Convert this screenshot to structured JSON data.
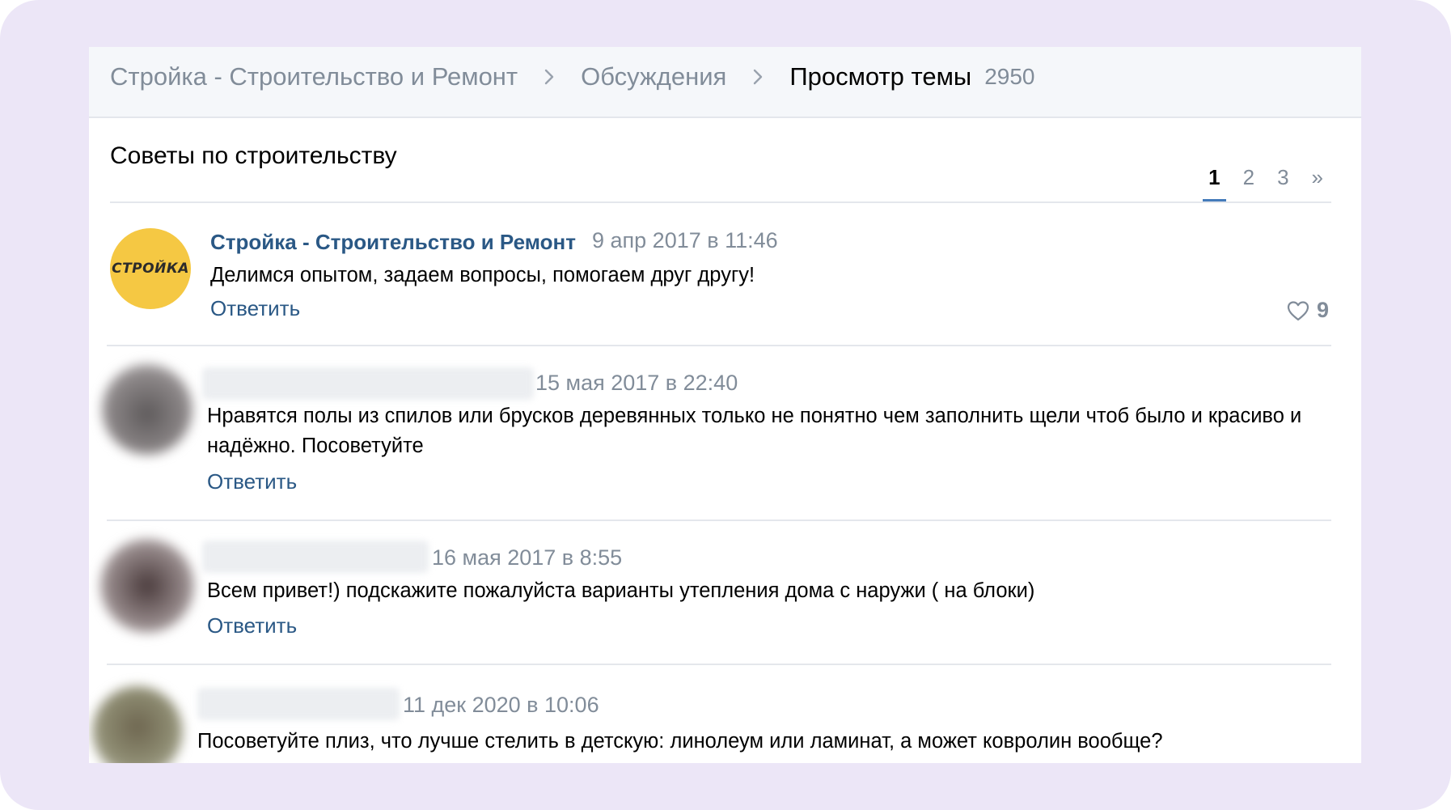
{
  "breadcrumb": {
    "group": "Стройка - Строительство и Ремонт",
    "section": "Обсуждения",
    "current": "Просмотр темы",
    "count": "2950"
  },
  "topic": {
    "title": "Советы по строительству"
  },
  "pagination": {
    "pages": [
      "1",
      "2",
      "3"
    ],
    "next": "»",
    "active_page": "1"
  },
  "posts": [
    {
      "author": "Стройка - Строительство и Ремонт",
      "avatar_text": "СТРОЙКА",
      "avatar_color": "#f5c843",
      "date": "9 апр 2017 в 11:46",
      "text": "Делимся опытом, задаем вопросы, помогаем друг другу!",
      "reply": "Ответить",
      "likes": "9"
    },
    {
      "date": "15 мая 2017 в 22:40",
      "text": "Нравятся полы из спилов или брусков деревянных только не понятно чем заполнить щели чтоб было и красиво и надёжно. Посоветуйте",
      "reply": "Ответить"
    },
    {
      "date": "16 мая 2017 в 8:55",
      "text": "Всем привет!) подскажите пожалуйста варианты утепления дома с наружи ( на блоки)",
      "reply": "Ответить"
    },
    {
      "date": "11 дек 2020 в 10:06",
      "text": "Посоветуйте плиз, что лучше стелить в детскую: линолеум или ламинат, а может ковролин вообще?"
    }
  ],
  "colors": {
    "frame_background": "#ece6f7",
    "link": "#2a5885",
    "muted": "#818c99",
    "accent": "#447bba"
  },
  "icons": {
    "breadcrumb_separator": "chevron-right-icon",
    "like": "heart-icon"
  }
}
